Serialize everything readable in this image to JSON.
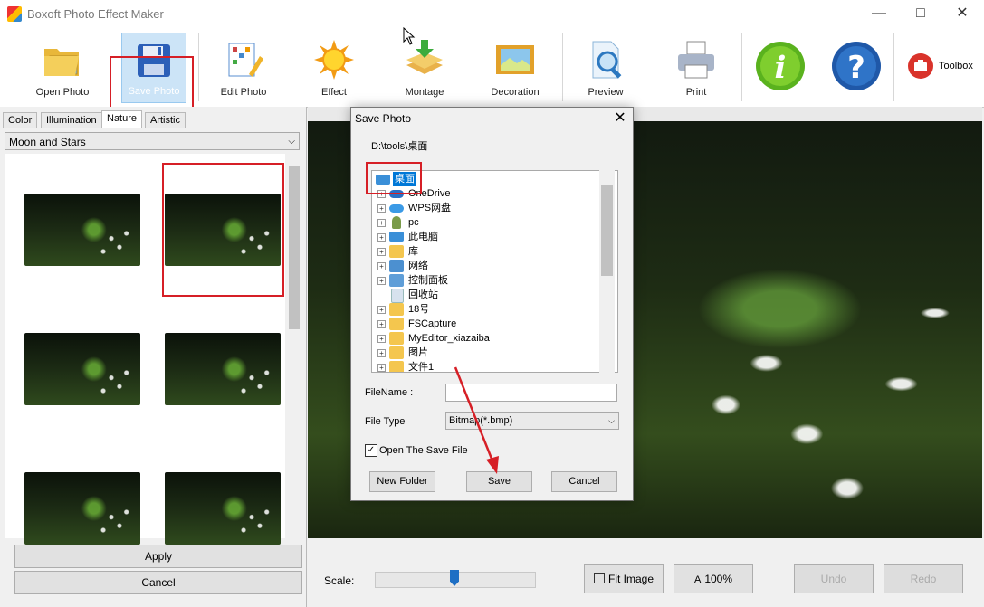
{
  "app": {
    "title": "Boxoft Photo Effect Maker"
  },
  "toolbar": {
    "open_photo": "Open Photo",
    "save_photo": "Save Photo",
    "edit_photo": "Edit Photo",
    "effect": "Effect",
    "montage": "Montage",
    "decoration": "Decoration",
    "preview": "Preview",
    "print": "Print",
    "toolbox": "Toolbox"
  },
  "left_panel": {
    "tabs": [
      "Color",
      "Illumination",
      "Nature",
      "Artistic"
    ],
    "active_tab": "Nature",
    "preset": "Moon and Stars",
    "apply": "Apply",
    "cancel": "Cancel"
  },
  "bottom": {
    "scale_label": "Scale:",
    "scale_value": 0.5,
    "fit_image": "Fit Image",
    "zoom_100": "100%",
    "undo": "Undo",
    "redo": "Redo"
  },
  "dialog": {
    "title": "Save Photo",
    "path": "D:\\tools\\桌面",
    "tree": [
      "桌面",
      "OneDrive",
      "WPS网盘",
      "pc",
      "此电脑",
      "库",
      "网络",
      "控制面板",
      "回收站",
      "18号",
      "FSCapture",
      "MyEditor_xiazaiba",
      "图片",
      "文件1"
    ],
    "filename_label": "FileName :",
    "filename_value": "",
    "filetype_label": "File Type",
    "filetype_value": "Bitmap(*.bmp)",
    "open_after_save": "Open The Save File",
    "new_folder": "New Folder",
    "save": "Save",
    "cancel": "Cancel"
  },
  "colors": {
    "accent_red": "#d61f26",
    "selection_blue": "#0078d7"
  }
}
